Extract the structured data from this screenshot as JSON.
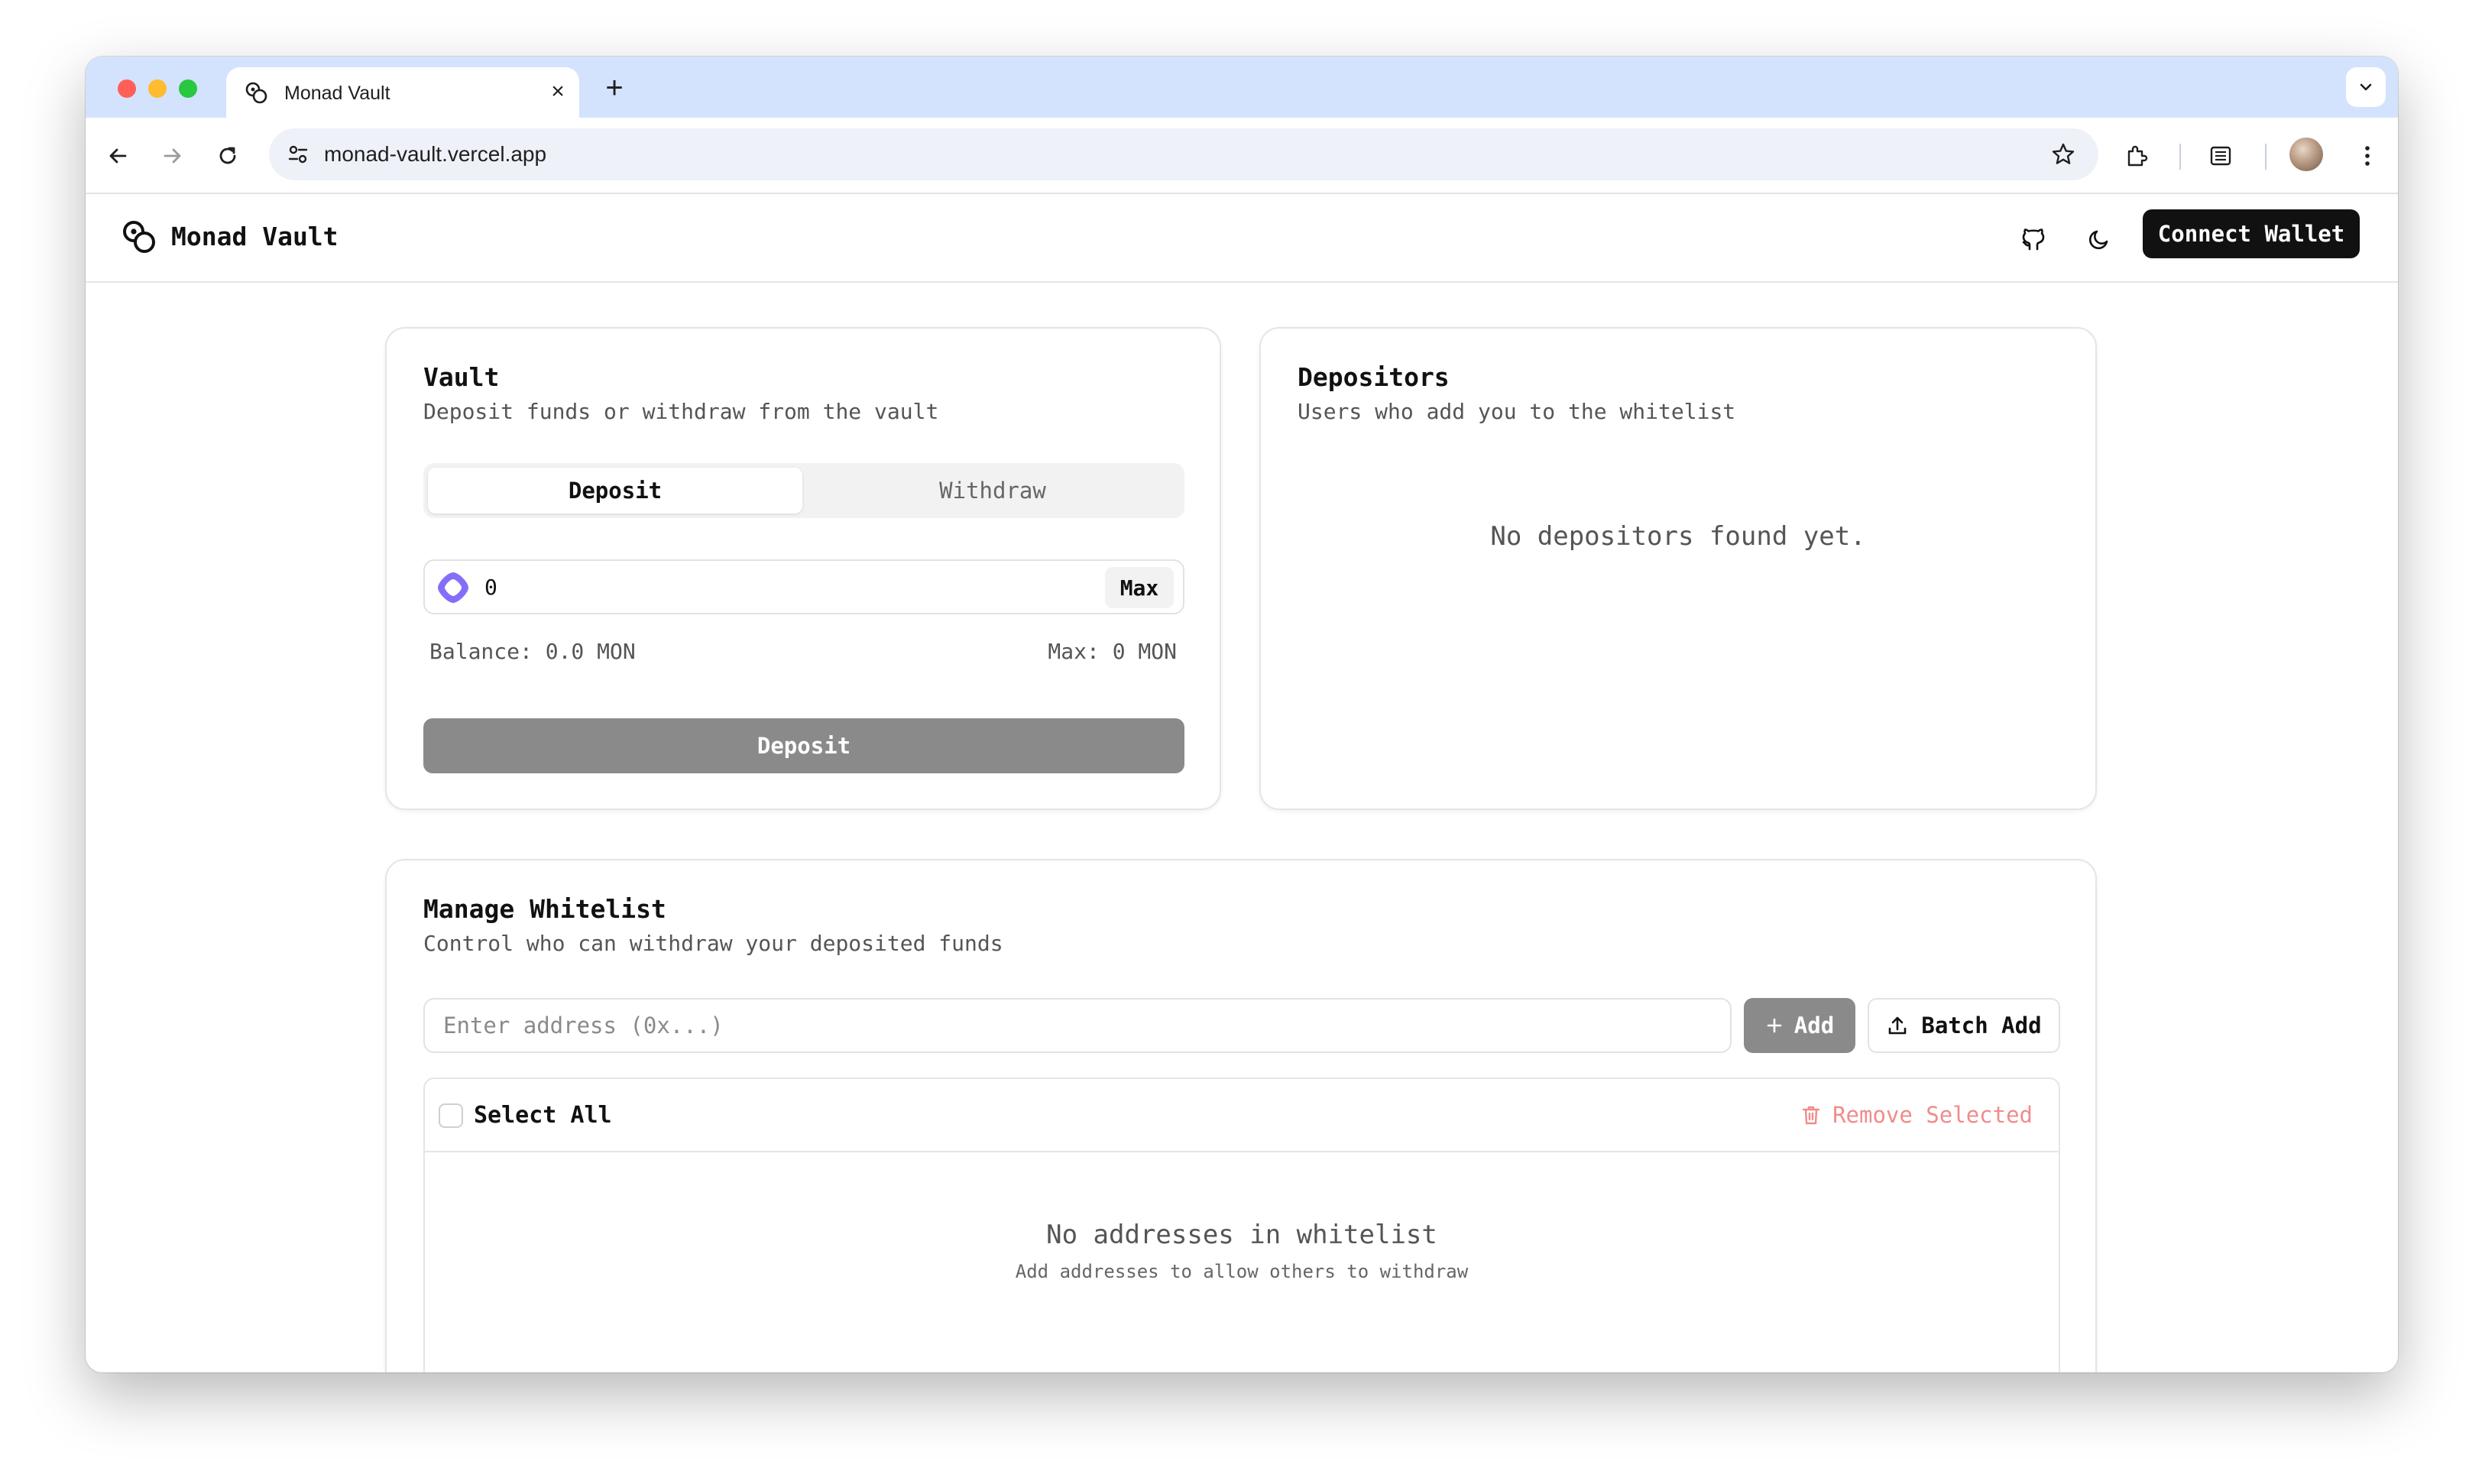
{
  "browser": {
    "tab_title": "Monad Vault",
    "tab_close": "×",
    "new_tab": "+",
    "url": "monad-vault.vercel.app"
  },
  "header": {
    "app_name": "Monad Vault",
    "connect_label": "Connect Wallet"
  },
  "vault": {
    "title": "Vault",
    "description": "Deposit funds or withdraw from the vault",
    "tabs": [
      {
        "label": "Deposit",
        "active": true
      },
      {
        "label": "Withdraw",
        "active": false
      }
    ],
    "amount_value": "0",
    "max_label": "Max",
    "balance": "Balance: 0.0 MON",
    "max_info": "Max: 0 MON",
    "submit_label": "Deposit"
  },
  "depositors": {
    "title": "Depositors",
    "description": "Users who add you to the whitelist",
    "empty": "No depositors found yet."
  },
  "whitelist": {
    "title": "Manage Whitelist",
    "description": "Control who can withdraw your deposited funds",
    "input_placeholder": "Enter address (0x...)",
    "add_label": "Add",
    "batch_label": "Batch Add",
    "select_all": "Select All",
    "remove_selected": "Remove Selected",
    "empty_title": "No addresses in whitelist",
    "empty_sub": "Add addresses to allow others to withdraw"
  },
  "colors": {
    "tabstrip": "#d3e3fd",
    "primary_dark": "#111111",
    "disabled_button": "#8a8a8a",
    "danger_text": "#f08c8c",
    "monad_purple": "#836ef9"
  },
  "icons": [
    "monad-logo-icon",
    "github-icon",
    "moon-icon",
    "plus-icon",
    "upload-icon",
    "trash-icon",
    "monad-token-icon"
  ]
}
